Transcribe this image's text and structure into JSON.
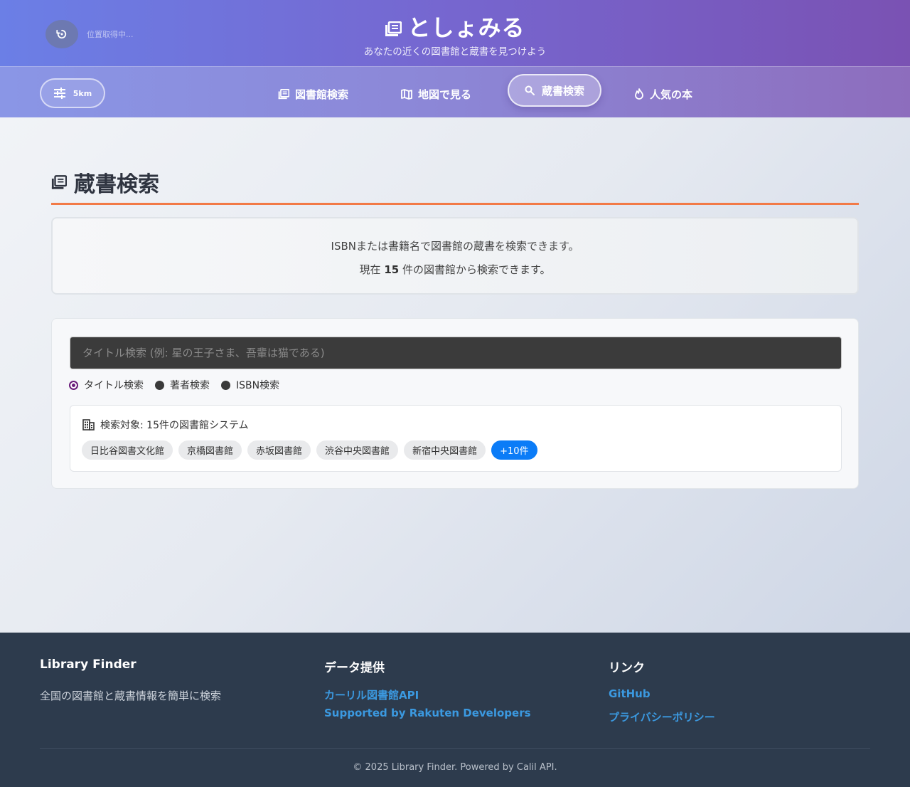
{
  "header": {
    "location_status": "位置取得中...",
    "brand": "としょみる",
    "tagline": "あなたの近くの図書館と蔵書を見つけよう",
    "icons": {
      "location": "refresh-location-icon",
      "brand": "library-books-icon"
    }
  },
  "nav": {
    "radius_label": "5km",
    "items": [
      {
        "label": "図書館検索",
        "icon": "library-books-icon"
      },
      {
        "label": "地図で見る",
        "icon": "map-icon"
      },
      {
        "label": "蔵書検索",
        "icon": "search-icon",
        "active": true
      },
      {
        "label": "人気の本",
        "icon": "fire-icon"
      }
    ]
  },
  "main": {
    "title": "蔵書検索",
    "info": {
      "line1": "ISBNまたは書籍名で図書館の蔵書を検索できます。",
      "line2_prefix": "現在 ",
      "count": "15",
      "line2_suffix": " 件の図書館から検索できます。"
    },
    "search": {
      "placeholder": "タイトル検索 (例: 星の王子さま、吾輩は猫である)",
      "value": "",
      "modes": [
        {
          "label": "タイトル検索",
          "selected": true
        },
        {
          "label": "著者検索",
          "selected": false
        },
        {
          "label": "ISBN検索",
          "selected": false
        }
      ]
    },
    "targets": {
      "label": "検索対象: 15件の図書館システム",
      "chips": [
        "日比谷図書文化館",
        "京橋図書館",
        "赤坂図書館",
        "渋谷中央図書館",
        "新宿中央図書館"
      ],
      "more": "+10件"
    }
  },
  "footer": {
    "col1": {
      "title": "Library Finder",
      "desc": "全国の図書館と蔵書情報を簡単に検索"
    },
    "col2": {
      "title": "データ提供",
      "links": [
        "カーリル図書館API",
        "Supported by Rakuten Developers"
      ]
    },
    "col3": {
      "title": "リンク",
      "links": [
        "GitHub",
        "プライバシーポリシー"
      ]
    },
    "copyright": "© 2025 Library Finder. Powered by Calil API."
  },
  "colors": {
    "accent_rule": "#f27a47",
    "chip_more": "#0b7cf7",
    "footer_bg": "#2d3b4d",
    "footer_link": "#3b99e0",
    "radio_selected": "#6a1b7a"
  }
}
